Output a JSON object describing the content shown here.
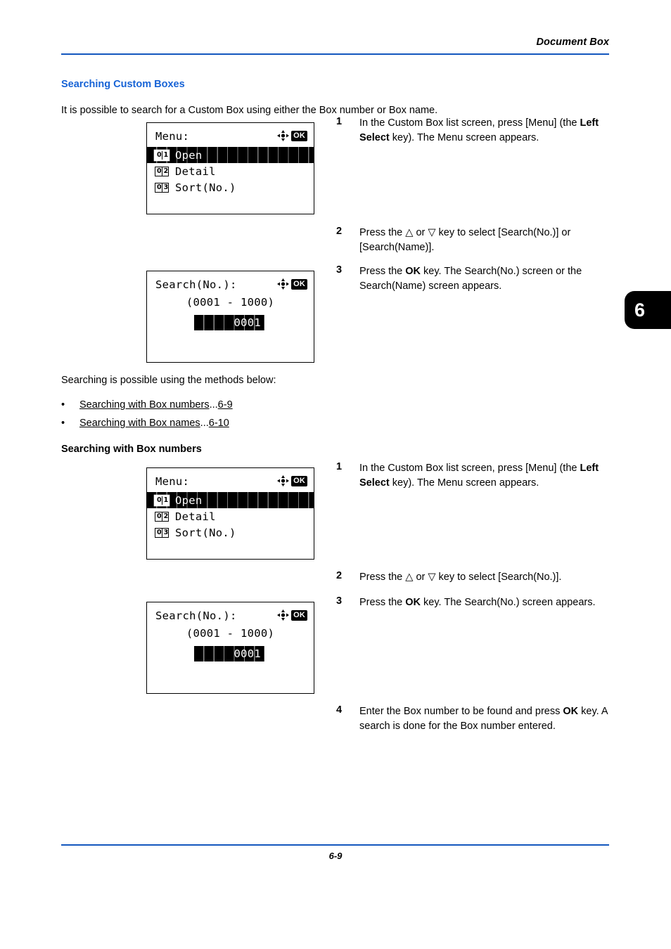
{
  "header": {
    "title": "Document Box"
  },
  "footer": {
    "page_number": "6-9"
  },
  "chapter_tab": {
    "number": "6"
  },
  "section": {
    "heading": "Searching Custom Boxes",
    "intro": "It is possible to search for a Custom Box using either the Box number or Box name.",
    "methods_intro": "Searching is possible using the methods below:",
    "subheading": "Searching with Box numbers"
  },
  "bullets": [
    {
      "marker": "•",
      "text": "Searching with Box numbers",
      "dots": "...",
      "page_ref": "6-9"
    },
    {
      "marker": "•",
      "text": "Searching with Box names",
      "dots": "...",
      "page_ref": "6-10"
    }
  ],
  "steps_first": [
    {
      "number": "1",
      "parts": [
        {
          "t": "In the Custom Box list screen, press [Menu] (the ",
          "b": false
        },
        {
          "t": "Left Select",
          "b": true
        },
        {
          "t": " key). The Menu screen appears.",
          "b": false
        }
      ]
    },
    {
      "number": "2",
      "parts": [
        {
          "t": "Press the △ or ▽ key to select [Search(No.)] or [Search(Name)].",
          "b": false
        }
      ]
    },
    {
      "number": "3",
      "parts": [
        {
          "t": "Press the ",
          "b": false
        },
        {
          "t": "OK",
          "b": true
        },
        {
          "t": " key. The Search(No.) screen or the Search(Name) screen appears.",
          "b": false
        }
      ]
    }
  ],
  "steps_second": [
    {
      "number": "1",
      "parts": [
        {
          "t": "In the Custom Box list screen, press [Menu] (the ",
          "b": false
        },
        {
          "t": "Left Select",
          "b": true
        },
        {
          "t": " key). The Menu screen appears.",
          "b": false
        }
      ]
    },
    {
      "number": "2",
      "parts": [
        {
          "t": "Press the △ or ▽ key to select [Search(No.)].",
          "b": false
        }
      ]
    },
    {
      "number": "3",
      "parts": [
        {
          "t": "Press the ",
          "b": false
        },
        {
          "t": "OK",
          "b": true
        },
        {
          "t": " key. The Search(No.) screen appears.",
          "b": false
        }
      ]
    },
    {
      "number": "4",
      "parts": [
        {
          "t": "Enter the Box number to be found and press ",
          "b": false
        },
        {
          "t": "OK",
          "b": true
        },
        {
          "t": " key. A search is done for the Box number entered.",
          "b": false
        }
      ]
    }
  ],
  "lcd_menu": {
    "title": "Menu:",
    "icons": {
      "dpad": "dpad-icon",
      "ok": "OK"
    },
    "rows": [
      {
        "badge": "01",
        "label": "Open",
        "selected": true
      },
      {
        "badge": "02",
        "label": "Detail",
        "selected": false
      },
      {
        "badge": "03",
        "label": "Sort(No.)",
        "selected": false
      }
    ]
  },
  "lcd_search": {
    "title": "Search(No.):",
    "icons": {
      "dpad": "dpad-icon",
      "ok": "OK"
    },
    "range": "(0001 - 1000)",
    "value": "0001"
  },
  "colors": {
    "rule": "#1357be",
    "heading_blue": "#1763d6",
    "ink": "#000000"
  }
}
